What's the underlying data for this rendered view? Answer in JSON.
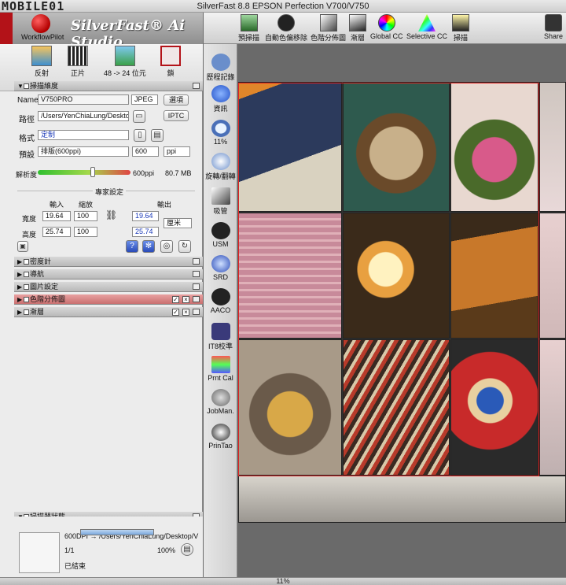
{
  "window": {
    "title": "SilverFast 8.8 EPSON Perfection V700/V750"
  },
  "watermark": "MOBILE01",
  "header": {
    "workflow_label": "WorkflowPilot",
    "brand": "SilverFast® Ai Studio"
  },
  "modes": [
    {
      "label": "反射",
      "icon": "reflective-icon"
    },
    {
      "label": "正片",
      "icon": "film-strip-icon"
    },
    {
      "label": "48 -> 24 位元",
      "icon": "bit-depth-icon"
    },
    {
      "label": "鎖",
      "icon": "lock-tools-icon"
    }
  ],
  "scan_settings": {
    "title": "掃描維度",
    "name_label": "Name",
    "name_value": "V750PRO",
    "format_value": "JPEG",
    "options_button": "選項",
    "path_label": "路徑",
    "path_value": "/Users/YenChiaLung/Desktop",
    "iptc_button": "IPTC",
    "type_label": "格式",
    "type_value": "定制",
    "preset_label": "預設",
    "preset_value": "排版(600ppi)",
    "ppi_value": "600",
    "ppi_unit": "ppi",
    "resolution_label": "解析度",
    "resolution_value": "600ppi",
    "file_size": "80.7 MB",
    "expert_label": "專家設定",
    "col_input": "輸入",
    "col_scale": "縮放",
    "col_output": "輸出",
    "width_label": "寬度",
    "height_label": "高度",
    "width_in": "19.64",
    "height_in": "25.74",
    "scale_w": "100",
    "scale_h": "100",
    "width_out": "19.64",
    "height_out": "25.74",
    "unit": "厘米"
  },
  "sections": [
    {
      "label": "密度計"
    },
    {
      "label": "導航"
    },
    {
      "label": "圖片設定"
    },
    {
      "label": "色階分佈圖"
    },
    {
      "label": "漸層"
    }
  ],
  "status": {
    "title": "掃描器狀態",
    "job_text": "600DPI → /Users/YenChiaLung/Desktop/V",
    "count": "1/1",
    "progress_percent": "100%",
    "progress_value": 1.0,
    "state": "已結束"
  },
  "toolbar": [
    {
      "label": "預掃描",
      "icon": "prescan-icon"
    },
    {
      "label": "自動色偏移除",
      "icon": "auto-cast-icon"
    },
    {
      "label": "色階分佈圖",
      "icon": "histogram-icon"
    },
    {
      "label": "漸層",
      "icon": "gradation-icon"
    },
    {
      "label": "Global CC",
      "icon": "global-cc-icon"
    },
    {
      "label": "Selective CC",
      "icon": "selective-cc-icon"
    },
    {
      "label": "掃描",
      "icon": "scan-icon"
    },
    {
      "label": "Share",
      "icon": "share-icon"
    }
  ],
  "tools": [
    {
      "label": "歷程記錄",
      "icon": "history-icon"
    },
    {
      "label": "資訊",
      "icon": "info-icon"
    },
    {
      "label": "11%",
      "icon": "zoom-icon"
    },
    {
      "label": "旋轉/翻轉",
      "icon": "rotate-icon"
    },
    {
      "label": "吸管",
      "icon": "eyedropper-icon"
    },
    {
      "label": "USM",
      "icon": "usm-icon"
    },
    {
      "label": "SRD",
      "icon": "srd-icon"
    },
    {
      "label": "AACO",
      "icon": "aaco-icon"
    },
    {
      "label": "IT8校準",
      "icon": "it8-icon"
    },
    {
      "label": "Prnt Cal",
      "icon": "print-cal-icon"
    },
    {
      "label": "JobMan.",
      "icon": "job-manager-icon"
    },
    {
      "label": "PrinTao",
      "icon": "printao-icon"
    }
  ],
  "bottom": {
    "zoom": "11%"
  },
  "colors": {
    "brand_red": "#b31218",
    "frame_red": "#e02020",
    "accent_blue": "#1a39b8"
  }
}
